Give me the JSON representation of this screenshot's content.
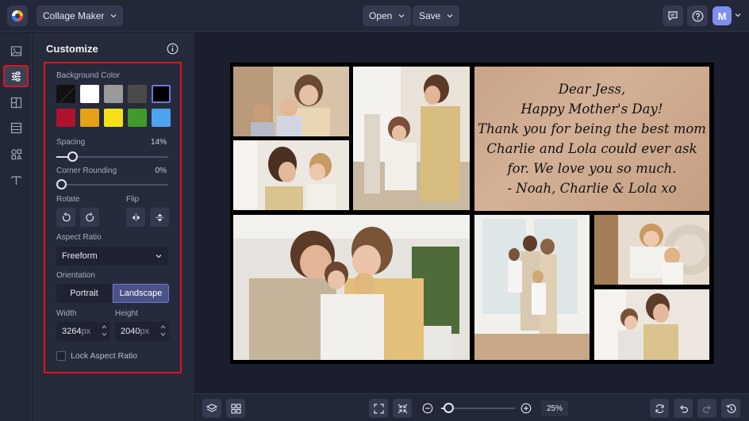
{
  "topbar": {
    "app_menu_label": "Collage Maker",
    "open_label": "Open",
    "save_label": "Save",
    "avatar_initial": "M"
  },
  "panel": {
    "title": "Customize",
    "background_color_label": "Background Color",
    "swatches": [
      "#0a0a0a",
      "#ffffff",
      "#9a9a9a",
      "#4a4a4a",
      "#000000",
      "#b0122e",
      "#e6a117",
      "#f5e11a",
      "#3f9b2a",
      "#4ea3ef"
    ],
    "selected_swatch": "#000000",
    "spacing_label": "Spacing",
    "spacing_value": "14%",
    "spacing_percent": 14,
    "corner_label": "Corner Rounding",
    "corner_value": "0%",
    "corner_percent": 0,
    "rotate_label": "Rotate",
    "flip_label": "Flip",
    "aspect_label": "Aspect Ratio",
    "aspect_value": "Freeform",
    "orientation_label": "Orientation",
    "portrait_label": "Portrait",
    "landscape_label": "Landscape",
    "orientation_selected": "Landscape",
    "width_label": "Width",
    "height_label": "Height",
    "width_value": "3264",
    "height_value": "2040",
    "unit": "px",
    "lock_label": "Lock Aspect Ratio",
    "lock_checked": false
  },
  "collage": {
    "note_lines": [
      "Dear Jess,",
      "Happy Mother's Day!",
      "Thank you for being the best mom",
      "Charlie and Lola could ever ask",
      "for. We love you so much.",
      "- Noah, Charlie & Lola  xo"
    ]
  },
  "bottombar": {
    "zoom_value": "25%",
    "zoom_percent": 25
  },
  "colors": {
    "accent": "#6a79e0",
    "highlight": "#e3121b"
  }
}
